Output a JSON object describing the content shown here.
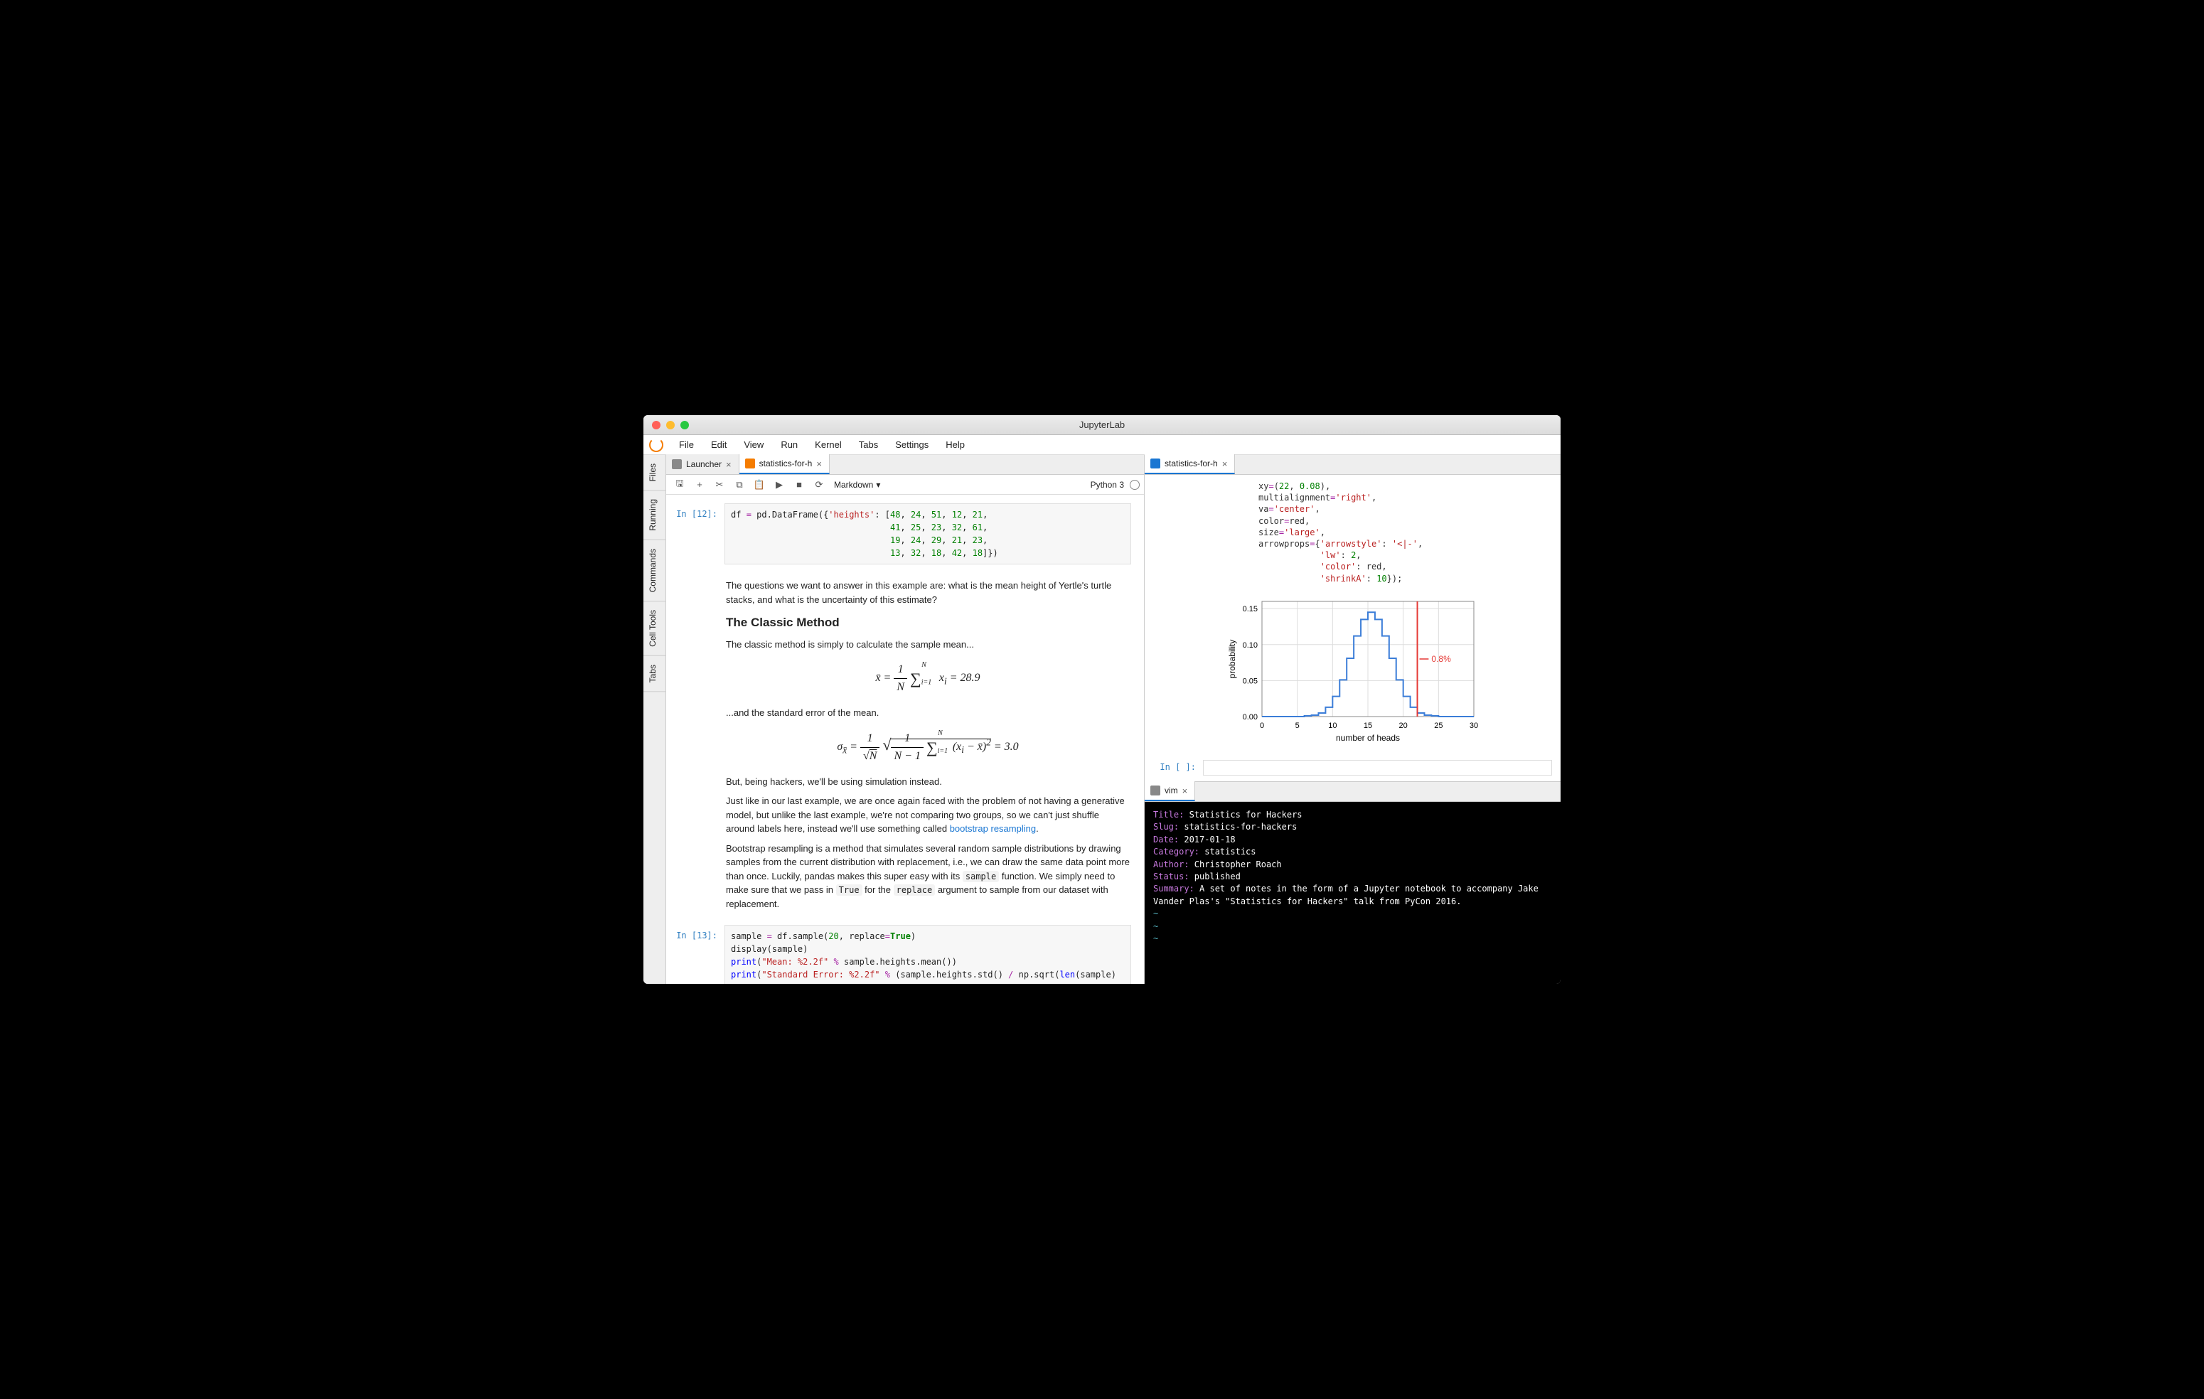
{
  "window": {
    "title": "JupyterLab"
  },
  "menu": [
    "File",
    "Edit",
    "View",
    "Run",
    "Kernel",
    "Tabs",
    "Settings",
    "Help"
  ],
  "side_tabs": [
    "Files",
    "Running",
    "Commands",
    "Cell Tools",
    "Tabs"
  ],
  "left": {
    "tabs": [
      {
        "label": "Launcher",
        "closable": true
      },
      {
        "label": "statistics-for-h",
        "closable": true,
        "active": true
      }
    ],
    "toolbar": {
      "cell_type": "Markdown",
      "kernel": "Python 3"
    },
    "cells": {
      "c12_prompt": "In [12]:",
      "c13_prompt": "In [13]:",
      "c12_code_html": "df <span class='s-op'>=</span> pd.DataFrame({<span class='s-str'>'heights'</span>: [<span class='s-num'>48</span>, <span class='s-num'>24</span>, <span class='s-num'>51</span>, <span class='s-num'>12</span>, <span class='s-num'>21</span>,\n                               <span class='s-num'>41</span>, <span class='s-num'>25</span>, <span class='s-num'>23</span>, <span class='s-num'>32</span>, <span class='s-num'>61</span>,\n                               <span class='s-num'>19</span>, <span class='s-num'>24</span>, <span class='s-num'>29</span>, <span class='s-num'>21</span>, <span class='s-num'>23</span>,\n                               <span class='s-num'>13</span>, <span class='s-num'>32</span>, <span class='s-num'>18</span>, <span class='s-num'>42</span>, <span class='s-num'>18</span>]})",
      "md1": "The questions we want to answer in this example are: what is the mean height of Yertle's turtle stacks, and what is the uncertainty of this estimate?",
      "h1": "The Classic Method",
      "md2": "The classic method is simply to calculate the sample mean...",
      "formula1_html": "x&#772; = <span style='display:inline-block;vertical-align:middle;'><span style='display:block;border-bottom:1px solid #000;padding:0 4px;'>1</span><span style='display:block;padding:0 4px;'>N</span></span> <span style='font-size:22px;vertical-align:middle;'>&sum;</span><sub style='font-size:10px;'>i=1</sub><sup style='font-size:10px;position:relative;left:-14px;top:-14px;'>N</sup> x<sub>i</sub> = 28.9",
      "md3": "...and the standard error of the mean.",
      "formula2_html": "&sigma;<sub>x&#772;</sub> = <span style='display:inline-block;vertical-align:middle;'><span style='display:block;border-bottom:1px solid #000;padding:0 4px;'>1</span><span style='display:block;padding:0 4px;'>&radic;<span style='text-decoration:overline;'>N</span></span></span> <span style='font-size:22px;'>&radic;</span><span style='border-top:1px solid #000;padding-top:2px;'><span style='display:inline-block;vertical-align:middle;'><span style='display:block;border-bottom:1px solid #000;padding:0 4px;'>1</span><span style='display:block;padding:0 4px;'>N &minus; 1</span></span> <span style='font-size:22px;vertical-align:middle;'>&sum;</span><sub style='font-size:10px;'>i=1</sub><sup style='font-size:10px;position:relative;left:-14px;top:-14px;'>N</sup>(x<sub>i</sub> &minus; x&#772;)<sup>2</sup></span> = 3.0",
      "md4": "But, being hackers, we'll be using simulation instead.",
      "md5_html": "Just like in our last example, we are once again faced with the problem of not having a generative model, but unlike the last example, we're not comparing two groups, so we can't just shuffle around labels here, instead we'll use something called <a href='#'>bootstrap resampling</a>.",
      "md6_html": "Bootstrap resampling is a method that simulates several random sample distributions by drawing samples from the current distribution with replacement, i.e., we can draw the same data point more than once. Luckily, pandas makes this super easy with its <code>sample</code> function. We simply need to make sure that we pass in <code>True</code> for the <code>replace</code> argument to sample from our dataset with replacement.",
      "c13_code_html": "sample <span class='s-op'>=</span> df.sample(<span class='s-num'>20</span>, replace<span class='s-op'>=</span><span class='s-kw'>True</span>)\ndisplay(sample)\n<span class='s-fn'>print</span>(<span class='s-str'>\"Mean: %2.2f\"</span> <span class='s-op'>%</span> sample.heights.mean())\n<span class='s-fn'>print</span>(<span class='s-str'>\"Standard Error: %2.2f\"</span> <span class='s-op'>%</span> (sample.heights.std() <span class='s-op'>/</span> np.sqrt(<span class='s-fn'>len</span>(sample)"
    }
  },
  "right_top": {
    "tab": "statistics-for-h",
    "code_out_html": "xy<span class='s-op'>=</span>(<span class='s-num'>22</span>, <span class='s-num'>0.08</span>),\nmultialignment<span class='s-op'>=</span><span class='s-str'>'right'</span>,\nva<span class='s-op'>=</span><span class='s-str'>'center'</span>,\ncolor<span class='s-op'>=</span>red,\nsize<span class='s-op'>=</span><span class='s-str'>'large'</span>,\narrowprops<span class='s-op'>=</span>{<span class='s-str'>'arrowstyle'</span>: <span class='s-str'>'&lt;|-'</span>,\n            <span class='s-str'>'lw'</span>: <span class='s-num'>2</span>,\n            <span class='s-str'>'color'</span>: red,\n            <span class='s-str'>'shrinkA'</span>: <span class='s-num'>10</span>});",
    "empty_prompt": "In [ ]:"
  },
  "right_bot": {
    "tab": "vim",
    "term_html": "<span class='lab'>Title:</span> Statistics for Hackers\n<span class='lab'>Slug:</span> statistics-for-hackers\n<span class='lab'>Date:</span> 2017-01-18\n<span class='lab'>Category:</span> statistics\n<span class='lab'>Author:</span> Christopher Roach\n<span class='lab'>Status:</span> published\n<span class='lab'>Summary:</span> A set of notes in the form of a Jupyter notebook to accompany Jake Vander Plas's \"Statistics for Hackers\" talk from PyCon 2016.\n<span class='tilde'>~</span>\n<span class='tilde'>~</span>\n<span class='tilde'>~</span>"
  },
  "chart_data": {
    "type": "line-step",
    "xlabel": "number of heads",
    "ylabel": "probability",
    "xlim": [
      0,
      30
    ],
    "ylim": [
      0,
      0.16
    ],
    "xticks": [
      0,
      5,
      10,
      15,
      20,
      25,
      30
    ],
    "yticks": [
      0.0,
      0.05,
      0.1,
      0.15
    ],
    "x": [
      0,
      1,
      2,
      3,
      4,
      5,
      6,
      7,
      8,
      9,
      10,
      11,
      12,
      13,
      14,
      15,
      16,
      17,
      18,
      19,
      20,
      21,
      22,
      23,
      24,
      25,
      26,
      27,
      28,
      29,
      30
    ],
    "y": [
      0,
      0,
      0,
      0,
      0,
      0,
      0.001,
      0.002,
      0.005,
      0.013,
      0.028,
      0.051,
      0.081,
      0.112,
      0.135,
      0.145,
      0.135,
      0.112,
      0.081,
      0.051,
      0.028,
      0.013,
      0.005,
      0.002,
      0.001,
      0,
      0,
      0,
      0,
      0,
      0
    ],
    "vline_x": 22,
    "annotation": {
      "text": "0.8%",
      "x": 24,
      "y": 0.08
    }
  }
}
